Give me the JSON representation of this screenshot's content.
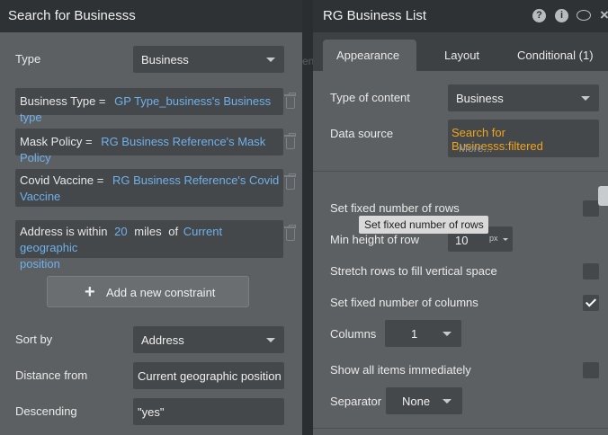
{
  "left_panel": {
    "title": "Search for Businesss",
    "type_label": "Type",
    "type_value": "Business",
    "constraints": [
      {
        "key": "Business Type =",
        "value": "GP Type_business's Business type"
      },
      {
        "key": "Mask Policy =",
        "value": "RG Business Reference's Mask Policy"
      },
      {
        "key": "Covid Vaccine =",
        "value_line1": "RG Business Reference's Covid",
        "value_line2": "Vaccine"
      },
      {
        "key": "Address is within",
        "distance": "20",
        "unit": "miles",
        "of": "of",
        "value_line1": "Current geographic",
        "value_line2": "position"
      }
    ],
    "add_constraint": "Add a new constraint",
    "sort_by_label": "Sort by",
    "sort_by_value": "Address",
    "distance_from_label": "Distance from",
    "distance_from_value": "Current geographic position",
    "descending_label": "Descending",
    "descending_value": "\"yes\""
  },
  "middle_strip": {
    "text": "en"
  },
  "right_panel": {
    "title": "RG Business List",
    "header_icons": [
      "help-icon",
      "info-icon",
      "comment-icon",
      "close-icon"
    ],
    "tabs": [
      "Appearance",
      "Layout",
      "Conditional (1)"
    ],
    "active_tab": "Appearance",
    "type_of_content_label": "Type of content",
    "type_of_content_value": "Business",
    "data_source_label": "Data source",
    "data_source_value": "Search for Businesss:filtered",
    "data_source_more": "More...",
    "fixed_rows_label": "Set fixed number of rows",
    "tooltip": "Set fixed number of rows",
    "min_height_label": "Min height of row",
    "min_height_value": "10",
    "min_height_unit": "px",
    "stretch_label": "Stretch rows to fill vertical space",
    "fixed_cols_label": "Set fixed number of columns",
    "columns_label": "Columns",
    "columns_value": "1",
    "show_all_label": "Show all items immediately",
    "separator_label": "Separator",
    "separator_value": "None",
    "checkboxes": {
      "fixed_rows": false,
      "stretch": false,
      "fixed_cols": true,
      "show_all": false
    }
  }
}
